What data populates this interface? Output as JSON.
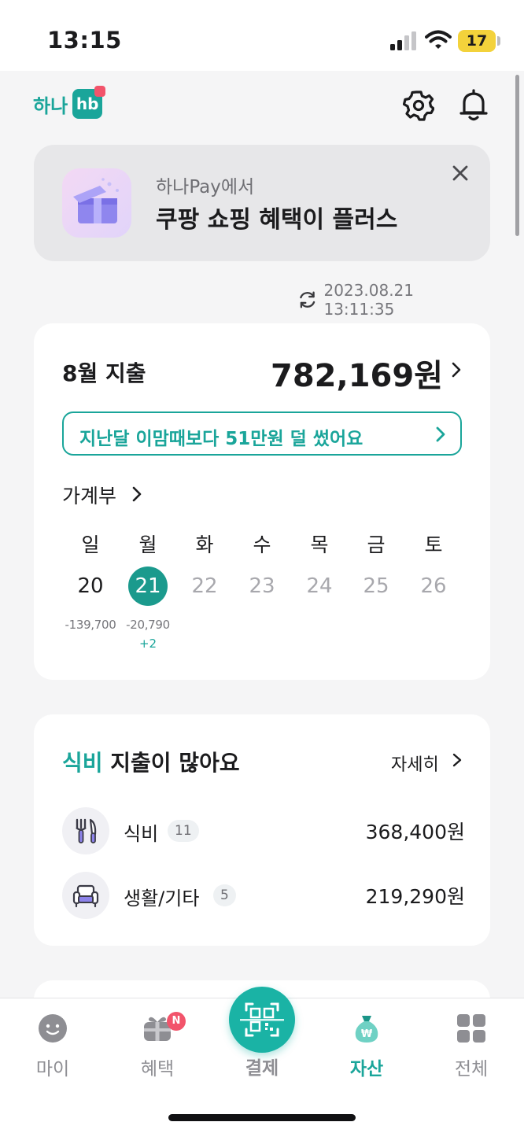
{
  "status_bar": {
    "time": "13:15",
    "battery": "17"
  },
  "header": {
    "logo_text": "하나",
    "logo_mark": "hb",
    "settings_icon": "gear-icon",
    "notification_icon": "bell-icon"
  },
  "promo": {
    "subtitle": "하나Pay에서",
    "title": "쿠팡 쇼핑 혜택이 플러스",
    "close_icon": "close-icon"
  },
  "sync": {
    "timestamp": "2023.08.21 13:11:35"
  },
  "spending": {
    "title": "8월 지출",
    "amount": "782,169원",
    "comparison": "지난달 이맘때보다 51만원 덜 썼어요",
    "ledger_label": "가계부",
    "weekdays": [
      "일",
      "월",
      "화",
      "수",
      "목",
      "금",
      "토"
    ],
    "days": [
      "20",
      "21",
      "22",
      "23",
      "24",
      "25",
      "26"
    ],
    "selected_day": "21",
    "expenses": {
      "20": "-139,700",
      "21": "-20,790"
    },
    "extra": {
      "21": "+2"
    }
  },
  "category": {
    "title_highlight": "식비",
    "title_rest": " 지출이 많아요",
    "more_label": "자세히",
    "items": [
      {
        "name": "식비",
        "count": "11",
        "amount": "368,400원",
        "icon": "utensils-icon"
      },
      {
        "name": "생활/기타",
        "count": "5",
        "amount": "219,290원",
        "icon": "armchair-icon"
      }
    ]
  },
  "tabbar": {
    "tabs": [
      {
        "label": "마이",
        "icon": "face-icon",
        "active": false
      },
      {
        "label": "혜택",
        "icon": "gift-icon",
        "active": false
      },
      {
        "label": "결제",
        "icon": "qr-scan-icon",
        "active": false
      },
      {
        "label": "자산",
        "icon": "money-bag-icon",
        "active": true
      },
      {
        "label": "전체",
        "icon": "grid-icon",
        "active": false
      }
    ],
    "benefit_badge": "N"
  },
  "colors": {
    "accent": "#1aa59a",
    "badge": "#f2546b"
  }
}
